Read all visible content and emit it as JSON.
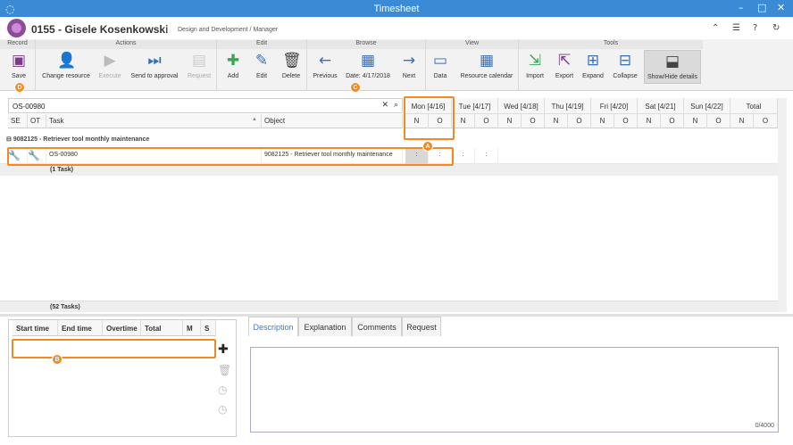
{
  "window": {
    "title": "Timesheet"
  },
  "header": {
    "name": "0155 - Gisele Kosenkowski",
    "separator": "|",
    "role": "Design and Development / Manager"
  },
  "ribbon": {
    "groups": [
      "Record",
      "Actions",
      "Edit",
      "Browse",
      "View",
      "Tools"
    ],
    "buttons": {
      "save": "Save",
      "change_resource": "Change resource",
      "execute": "Execute",
      "send_to_approval": "Send to approval",
      "request": "Request",
      "add": "Add",
      "edit": "Edit",
      "delete": "Delete",
      "previous": "Previous",
      "date": "Date: 4/17/2018",
      "next": "Next",
      "data": "Data",
      "resource_calendar": "Resource calendar",
      "import": "Import",
      "export": "Export",
      "expand": "Expand",
      "collapse": "Collapse",
      "show_hide_details": "Show/Hide details"
    }
  },
  "search": {
    "value": "OS-00980"
  },
  "columns": {
    "se": "SE",
    "ot": "OT",
    "task": "Task",
    "object": "Object"
  },
  "days": [
    "Mon [4/16]",
    "Tue [4/17]",
    "Wed [4/18]",
    "Thu [4/19]",
    "Fri [4/20]",
    "Sat [4/21]",
    "Sun [4/22]",
    "Total"
  ],
  "sub_labels": {
    "normal": "N",
    "overtime": "O"
  },
  "group_row": "9082125 - Retriever tool monthly maintenance",
  "task_row": {
    "task": "OS-00980",
    "object": "9082125 - Retriever tool monthly maintenance",
    "cells": [
      ":",
      ":",
      ":",
      ":"
    ]
  },
  "subtotal": "(1 Task)",
  "total": "(52 Tasks)",
  "time_table": {
    "columns": [
      "Start time",
      "End time",
      "Overtime",
      "Total",
      "M",
      "S"
    ]
  },
  "tabs": [
    "Description",
    "Explanation",
    "Comments",
    "Request"
  ],
  "char_counter": "0/4000",
  "markers": {
    "a": "A",
    "b": "B",
    "c": "C",
    "d": "D"
  },
  "colors": {
    "titlebar": "#3a8ad6",
    "highlight": "#f08a24",
    "accent": "#3a7cc8"
  }
}
